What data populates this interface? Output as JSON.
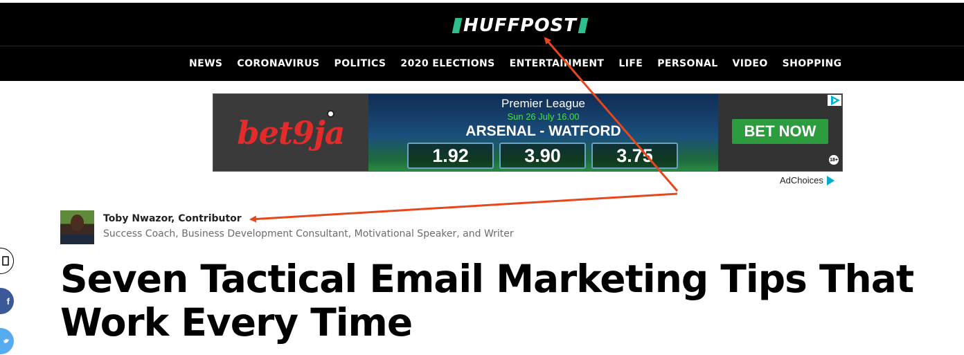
{
  "masthead": {
    "logo_text": "HUFFPOST",
    "accent_color": "#2fbf8f"
  },
  "nav": {
    "items": [
      "NEWS",
      "CORONAVIRUS",
      "POLITICS",
      "2020 ELECTIONS",
      "ENTERTAINMENT",
      "LIFE",
      "PERSONAL",
      "VIDEO",
      "SHOPPING"
    ]
  },
  "ad": {
    "brand": "bet9ja",
    "league": "Premier League",
    "date": "Sun 26 July 16.00",
    "match": "ARSENAL - WATFORD",
    "odds": [
      "1.92",
      "3.90",
      "3.75"
    ],
    "cta": "BET NOW",
    "age_badge": "18+",
    "adchoices_label": "AdChoices"
  },
  "byline": {
    "author": "Toby Nwazor, Contributor",
    "bio": "Success Coach, Business Development Consultant, Motivational Speaker, and Writer"
  },
  "share_icons": [
    "comment-icon",
    "facebook-icon",
    "twitter-icon"
  ],
  "article": {
    "headline": "Seven Tactical Email Marketing Tips That Work Every Time"
  },
  "annotation_color": "#e8461b"
}
